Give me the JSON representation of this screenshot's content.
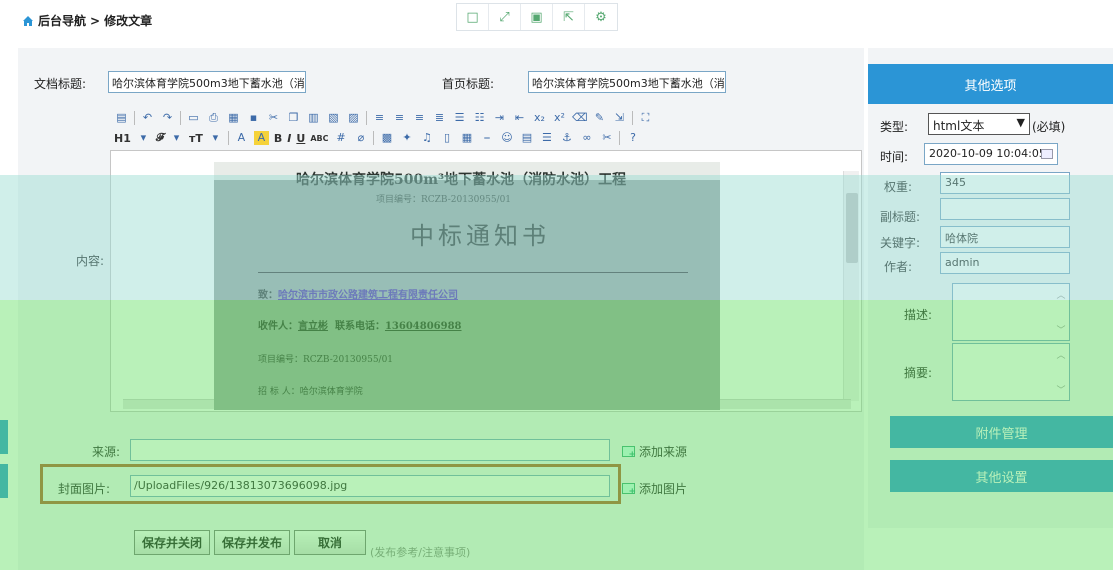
{
  "breadcrumb": {
    "home": "后台导航",
    "current": "修改文章",
    "separator": ">"
  },
  "toolbar_icons": [
    "window-icon",
    "expand-icon",
    "save-icon",
    "share-icon",
    "settings-icon"
  ],
  "form": {
    "doc_title_label": "文档标题:",
    "doc_title_value": "哈尔滨体育学院500m3地下蓄水池（消",
    "home_title_label": "首页标题:",
    "home_title_value": "哈尔滨体育学院500m3地下蓄水池（消",
    "content_label": "内容:",
    "source_label": "来源:",
    "source_value": "",
    "add_source": "添加来源",
    "cover_label": "封面图片:",
    "cover_value": "/UploadFiles/926/13813073696098.jpg",
    "add_image": "添加图片"
  },
  "editor": {
    "heading_btn": "H1",
    "font_btn": "𝓕",
    "size_btn": "тT",
    "bold": "B",
    "italic": "I",
    "underline": "U",
    "abc": "ABC"
  },
  "document_image": {
    "title": "哈尔滨体育学院500m³地下蓄水池（消防水池）工程",
    "project_no": "项目编号：RCZB-20130955/01",
    "heading": "中标通知书",
    "to_label": "致：",
    "to_value": "哈尔滨市市政公路建筑工程有限责任公司",
    "recipient": "收件人：",
    "recipient_name": "言立彬",
    "phone_label": "联系电话：",
    "phone": "13604806988",
    "project_no2": "项目编号：RCZB-20130955/01",
    "bidder": "招 标 人：哈尔滨体育学院"
  },
  "options": {
    "header": "其他选项",
    "type_label": "类型:",
    "type_value": "html文本",
    "type_required": "(必填)",
    "time_label": "时间:",
    "time_value": "2020-10-09 10:04:05",
    "weight_label": "权重:",
    "weight_value": "345",
    "subtitle_label": "副标题:",
    "subtitle_value": "",
    "keywords_label": "关键字:",
    "keywords_value": "哈体院",
    "author_label": "作者:",
    "author_value": "admin",
    "desc_label": "描述:",
    "summary_label": "摘要:",
    "attachments": "附件管理",
    "other_settings": "其他设置"
  },
  "actions": {
    "save_close": "保存并关闭",
    "save_publish": "保存并发布",
    "cancel": "取消",
    "hint": "(发布参考/注意事项)"
  },
  "colors": {
    "accent": "#2b95d6",
    "highlight_frame": "#b35a2a",
    "overlay_green": "#64e164"
  }
}
